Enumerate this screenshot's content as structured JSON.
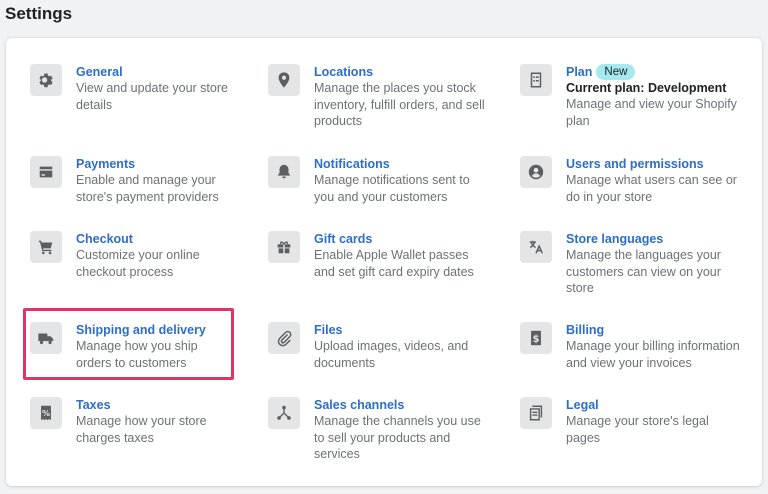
{
  "page": {
    "title": "Settings"
  },
  "settings": {
    "items": [
      {
        "name": "general",
        "icon": "gear-icon",
        "title": "General",
        "desc": "View and update your store details"
      },
      {
        "name": "locations",
        "icon": "location-pin-icon",
        "title": "Locations",
        "desc": "Manage the places you stock inventory, fulfill orders, and sell products"
      },
      {
        "name": "plan",
        "icon": "plan-document-icon",
        "title": "Plan",
        "badge": "New",
        "subtitle": "Current plan: Development",
        "desc": "Manage and view your Shopify plan"
      },
      {
        "name": "payments",
        "icon": "payments-card-icon",
        "title": "Payments",
        "desc": "Enable and manage your store's payment providers"
      },
      {
        "name": "notifications",
        "icon": "bell-icon",
        "title": "Notifications",
        "desc": "Manage notifications sent to you and your customers"
      },
      {
        "name": "users-and-permissions",
        "icon": "user-circle-icon",
        "title": "Users and permissions",
        "desc": "Manage what users can see or do in your store"
      },
      {
        "name": "checkout",
        "icon": "shopping-cart-icon",
        "title": "Checkout",
        "desc": "Customize your online checkout process"
      },
      {
        "name": "gift-cards",
        "icon": "gift-icon",
        "title": "Gift cards",
        "desc": "Enable Apple Wallet passes and set gift card expiry dates"
      },
      {
        "name": "store-languages",
        "icon": "translate-icon",
        "title": "Store languages",
        "desc": "Manage the languages your customers can view on your store"
      },
      {
        "name": "shipping-and-delivery",
        "icon": "delivery-truck-icon",
        "title": "Shipping and delivery",
        "desc": "Manage how you ship orders to customers"
      },
      {
        "name": "files",
        "icon": "paperclip-icon",
        "title": "Files",
        "desc": "Upload images, videos, and documents"
      },
      {
        "name": "billing",
        "icon": "billing-dollar-icon",
        "title": "Billing",
        "desc": "Manage your billing information and view your invoices"
      },
      {
        "name": "taxes",
        "icon": "tax-receipt-icon",
        "title": "Taxes",
        "desc": "Manage how your store charges taxes"
      },
      {
        "name": "sales-channels",
        "icon": "sales-channels-icon",
        "title": "Sales channels",
        "desc": "Manage the channels you use to sell your products and services"
      },
      {
        "name": "legal",
        "icon": "legal-document-icon",
        "title": "Legal",
        "desc": "Manage your store's legal pages"
      }
    ]
  },
  "colors": {
    "link": "#2c6ecb",
    "icon_bg": "#e4e5e7",
    "badge_bg": "#a4e8f2",
    "highlight": "#e0336a"
  }
}
